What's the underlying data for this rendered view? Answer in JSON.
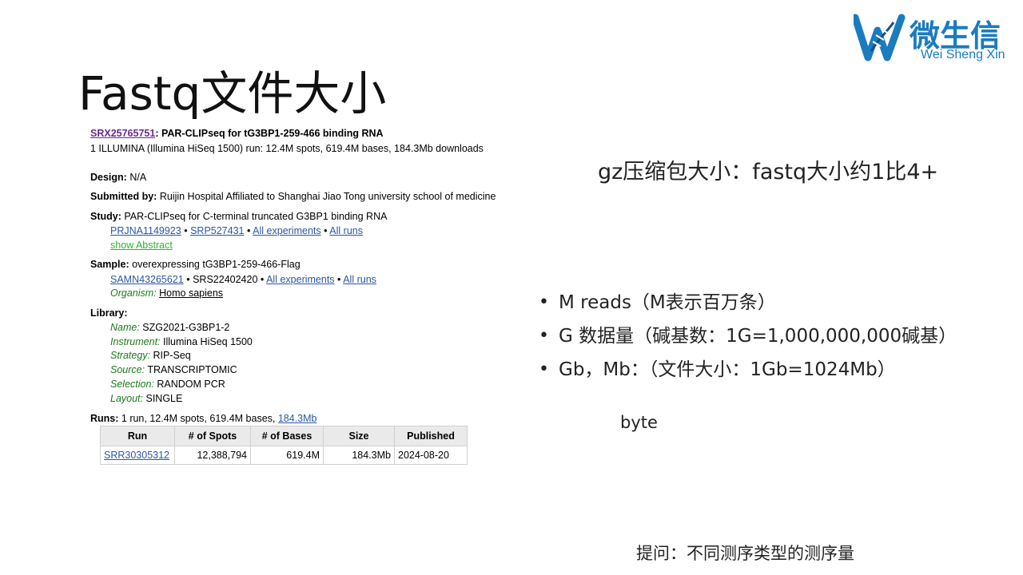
{
  "slide": {
    "title": "Fastq文件大小"
  },
  "logo": {
    "cn": "微生信",
    "en": "Wei Sheng Xin",
    "colors": {
      "primary": "#1b7bbf",
      "accent": "#1a4f8a"
    }
  },
  "record": {
    "accession": "SRX25765751",
    "title_rest": ": PAR-CLIPseq for tG3BP1-259-466 binding RNA",
    "run_summary": "1 ILLUMINA (Illumina HiSeq 1500) run: 12.4M spots, 619.4M bases, 184.3Mb downloads",
    "design_label": "Design:",
    "design_value": " N/A",
    "submitted_label": "Submitted by:",
    "submitted_value": " Ruijin Hospital Affiliated to Shanghai Jiao Tong university school of medicine",
    "study_label": "Study:",
    "study_value": " PAR-CLIPseq for C-terminal truncated G3BP1 binding RNA",
    "study_links": [
      "PRJNA1149923",
      "SRP527431",
      "All experiments",
      "All runs"
    ],
    "show_abstract": "show Abstract",
    "sample_label": "Sample:",
    "sample_value": " overexpressing tG3BP1-259-466-Flag",
    "sample_id": "SAMN43265621",
    "sample_srs": "SRS22402420",
    "sample_links": [
      "All experiments",
      "All runs"
    ],
    "organism_label": "Organism:",
    "organism_value": "Homo sapiens",
    "library_label": "Library:",
    "library": [
      {
        "label": "Name:",
        "value": " SZG2021-G3BP1-2"
      },
      {
        "label": "Instrument:",
        "value": " Illumina HiSeq 1500"
      },
      {
        "label": "Strategy:",
        "value": " RIP-Seq"
      },
      {
        "label": "Source:",
        "value": " TRANSCRIPTOMIC"
      },
      {
        "label": "Selection:",
        "value": " RANDOM PCR"
      },
      {
        "label": "Layout:",
        "value": " SINGLE"
      }
    ],
    "runs_label": "Runs:",
    "runs_text": " 1 run, 12.4M spots, 619.4M bases, ",
    "runs_link": "184.3Mb",
    "table": {
      "headers": [
        "Run",
        "# of Spots",
        "# of Bases",
        "Size",
        "Published"
      ],
      "rows": [
        [
          "SRR30305312",
          "12,388,794",
          "619.4M",
          "184.3Mb",
          "2024-08-20"
        ]
      ]
    }
  },
  "notes": {
    "gz": "gz压缩包大小：fastq大小约1比4+",
    "bullets": [
      "M reads（M表示百万条）",
      "G 数据量（碱基数：1G=1,000,000,000碱基）",
      "Gb，Mb：（文件大小：1Gb=1024Mb）"
    ],
    "byte": "byte",
    "question": "提问：不同测序类型的测序量"
  }
}
